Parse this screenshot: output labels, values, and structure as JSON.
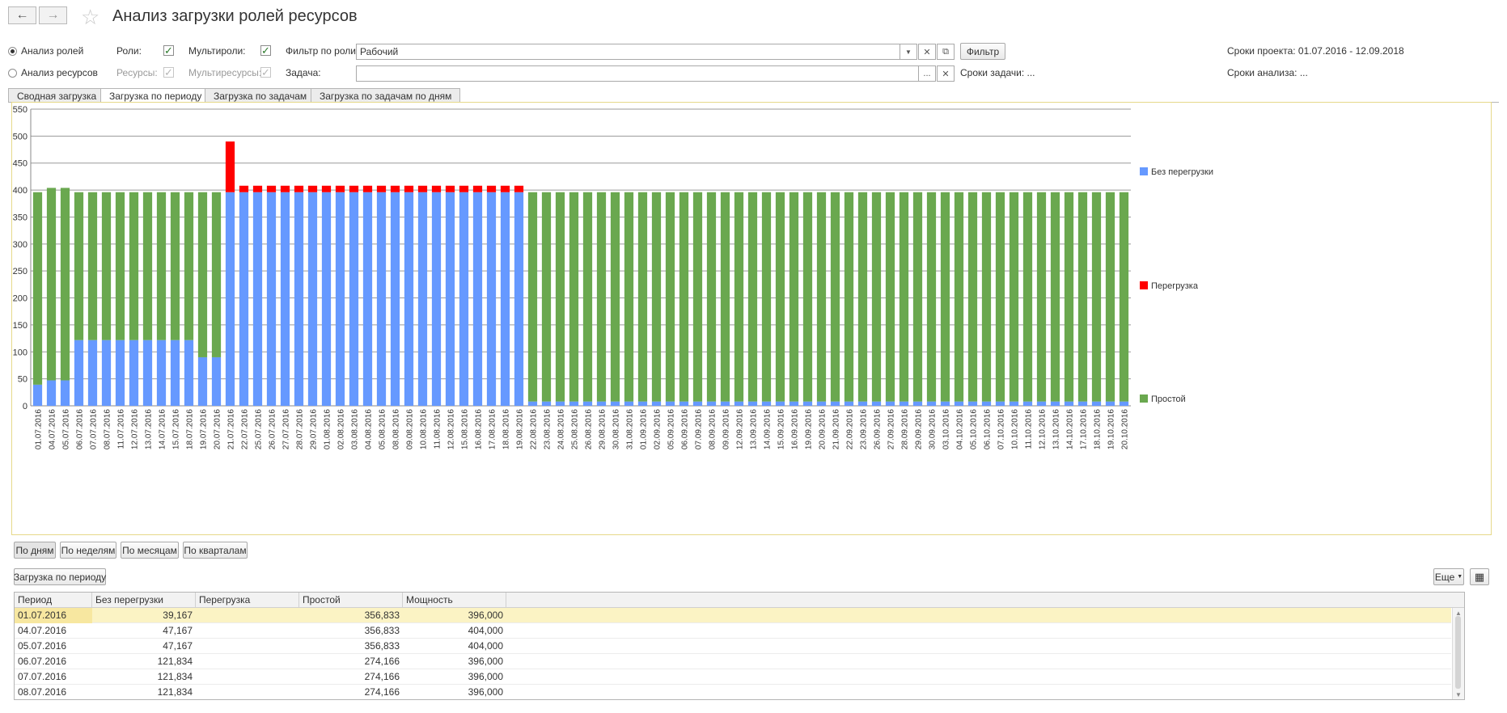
{
  "header": {
    "title": "Анализ загрузки ролей ресурсов"
  },
  "toolbar": {
    "back_icon": "arrow-left-icon",
    "forward_icon": "arrow-right-icon",
    "star_icon": "star-icon"
  },
  "filters": {
    "mode_roles": "Анализ ролей",
    "mode_resources": "Анализ ресурсов",
    "roles_label": "Роли:",
    "multiroles_label": "Мультироли:",
    "resources_label": "Ресурсы:",
    "multiresources_label": "Мультиресурсы:",
    "role_filter_label": "Фильтр по роли:",
    "role_filter_value": "Рабочий",
    "task_label": "Задача:",
    "task_value": "",
    "filter_button": "Фильтр",
    "task_dates": "Сроки задачи: ...",
    "project_dates": "Сроки проекта: 01.07.2016 - 12.09.2018",
    "analysis_dates": "Сроки анализа: ..."
  },
  "tabs": [
    {
      "label": "Сводная загрузка"
    },
    {
      "label": "Загрузка по периоду"
    },
    {
      "label": "Загрузка по задачам"
    },
    {
      "label": "Загрузка по задачам по дням"
    }
  ],
  "period_buttons": [
    "По дням",
    "По неделям",
    "По месяцам",
    "По кварталам"
  ],
  "section_button": "Загрузка по периоду",
  "more_button": "Еще",
  "colors": {
    "no_overload": "#6699ff",
    "overload": "#ff0000",
    "idle": "#6aa84f",
    "selection": "#fbf3c4"
  },
  "chart_data": {
    "type": "bar",
    "stacked": true,
    "ylim": [
      0,
      550
    ],
    "yticks": [
      0,
      50,
      100,
      150,
      200,
      250,
      300,
      350,
      400,
      450,
      500,
      550
    ],
    "legend_position": "right",
    "categories": [
      "01.07.2016",
      "04.07.2016",
      "05.07.2016",
      "06.07.2016",
      "07.07.2016",
      "08.07.2016",
      "11.07.2016",
      "12.07.2016",
      "13.07.2016",
      "14.07.2016",
      "15.07.2016",
      "18.07.2016",
      "19.07.2016",
      "20.07.2016",
      "21.07.2016",
      "22.07.2016",
      "25.07.2016",
      "26.07.2016",
      "27.07.2016",
      "28.07.2016",
      "29.07.2016",
      "01.08.2016",
      "02.08.2016",
      "03.08.2016",
      "04.08.2016",
      "05.08.2016",
      "08.08.2016",
      "09.08.2016",
      "10.08.2016",
      "11.08.2016",
      "12.08.2016",
      "15.08.2016",
      "16.08.2016",
      "17.08.2016",
      "18.08.2016",
      "19.08.2016",
      "22.08.2016",
      "23.08.2016",
      "24.08.2016",
      "25.08.2016",
      "26.08.2016",
      "29.08.2016",
      "30.08.2016",
      "31.08.2016",
      "01.09.2016",
      "02.09.2016",
      "05.09.2016",
      "06.09.2016",
      "07.09.2016",
      "08.09.2016",
      "09.09.2016",
      "12.09.2016",
      "13.09.2016",
      "14.09.2016",
      "15.09.2016",
      "16.09.2016",
      "19.09.2016",
      "20.09.2016",
      "21.09.2016",
      "22.09.2016",
      "23.09.2016",
      "26.09.2016",
      "27.09.2016",
      "28.09.2016",
      "29.09.2016",
      "30.09.2016",
      "03.10.2016",
      "04.10.2016",
      "05.10.2016",
      "06.10.2016",
      "07.10.2016",
      "10.10.2016",
      "11.10.2016",
      "12.10.2016",
      "13.10.2016",
      "14.10.2016",
      "17.10.2016",
      "18.10.2016",
      "19.10.2016",
      "20.10.2016"
    ],
    "series": [
      {
        "name": "Без перегрузки",
        "values": [
          39.167,
          47.167,
          47.167,
          121.834,
          121.834,
          121.834,
          121.834,
          121.834,
          121.834,
          121.834,
          121.834,
          121.834,
          90,
          90,
          396,
          396,
          396,
          396,
          396,
          396,
          396,
          396,
          396,
          396,
          396,
          396,
          396,
          396,
          396,
          396,
          396,
          396,
          396,
          396,
          396,
          396,
          8,
          8,
          8,
          8,
          8,
          8,
          8,
          8,
          8,
          8,
          8,
          8,
          8,
          8,
          8,
          8,
          8,
          8,
          8,
          8,
          8,
          8,
          8,
          8,
          8,
          8,
          8,
          8,
          8,
          8,
          8,
          8,
          8,
          8,
          8,
          8,
          8,
          8,
          8,
          8,
          8,
          8,
          8,
          8
        ]
      },
      {
        "name": "Перегрузка",
        "values": [
          0,
          0,
          0,
          0,
          0,
          0,
          0,
          0,
          0,
          0,
          0,
          0,
          0,
          0,
          94,
          12,
          12,
          12,
          12,
          12,
          12,
          12,
          12,
          12,
          12,
          12,
          12,
          12,
          12,
          12,
          12,
          12,
          12,
          12,
          12,
          12,
          0,
          0,
          0,
          0,
          0,
          0,
          0,
          0,
          0,
          0,
          0,
          0,
          0,
          0,
          0,
          0,
          0,
          0,
          0,
          0,
          0,
          0,
          0,
          0,
          0,
          0,
          0,
          0,
          0,
          0,
          0,
          0,
          0,
          0,
          0,
          0,
          0,
          0,
          0,
          0,
          0,
          0,
          0,
          0
        ]
      },
      {
        "name": "Простой",
        "values": [
          356.833,
          356.833,
          356.833,
          274.166,
          274.166,
          274.166,
          274.166,
          274.166,
          274.166,
          274.166,
          274.166,
          274.166,
          306,
          306,
          0,
          0,
          0,
          0,
          0,
          0,
          0,
          0,
          0,
          0,
          0,
          0,
          0,
          0,
          0,
          0,
          0,
          0,
          0,
          0,
          0,
          0,
          388,
          388,
          388,
          388,
          388,
          388,
          388,
          388,
          388,
          388,
          388,
          388,
          388,
          388,
          388,
          388,
          388,
          388,
          388,
          388,
          388,
          388,
          388,
          388,
          388,
          388,
          388,
          388,
          388,
          388,
          388,
          388,
          388,
          388,
          388,
          388,
          388,
          388,
          388,
          388,
          388,
          388,
          388,
          388
        ]
      }
    ]
  },
  "table": {
    "columns": [
      "Период",
      "Без перегрузки",
      "Перегрузка",
      "Простой",
      "Мощность"
    ],
    "rows": [
      [
        "01.07.2016",
        "39,167",
        "",
        "356,833",
        "396,000"
      ],
      [
        "04.07.2016",
        "47,167",
        "",
        "356,833",
        "404,000"
      ],
      [
        "05.07.2016",
        "47,167",
        "",
        "356,833",
        "404,000"
      ],
      [
        "06.07.2016",
        "121,834",
        "",
        "274,166",
        "396,000"
      ],
      [
        "07.07.2016",
        "121,834",
        "",
        "274,166",
        "396,000"
      ],
      [
        "08.07.2016",
        "121,834",
        "",
        "274,166",
        "396,000"
      ]
    ]
  }
}
